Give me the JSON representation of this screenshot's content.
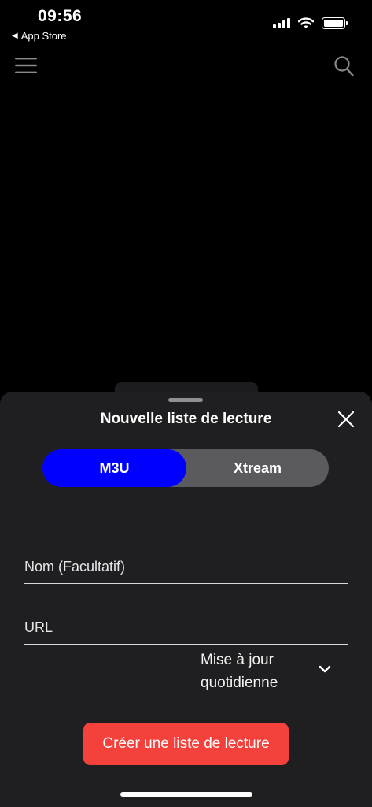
{
  "status_bar": {
    "time": "09:56",
    "back_label": "App Store",
    "back_glyph": "◀",
    "icons": [
      "signal-icon",
      "wifi-icon",
      "battery-icon"
    ]
  },
  "header": {
    "menu_icon": "hamburger-menu-icon",
    "search_icon": "search-icon"
  },
  "sheet": {
    "title": "Nouvelle liste de lecture",
    "close_icon": "close-icon",
    "segments": [
      {
        "label": "M3U",
        "selected": true
      },
      {
        "label": "Xtream",
        "selected": false
      }
    ],
    "name_field": {
      "value": "",
      "placeholder": "Nom (Facultatif)"
    },
    "url_field": {
      "value": "",
      "placeholder": "URL"
    },
    "update_schedule": {
      "label": "Mise à jour quotidienne",
      "icon": "chevron-down-icon"
    },
    "create_button": "Créer une liste de lecture"
  },
  "colors": {
    "background": "#000000",
    "sheet": "#1f1f21",
    "segment_selected": "#0000ff",
    "segment_track": "#5b5b5f",
    "primary_button": "#f4413b"
  }
}
